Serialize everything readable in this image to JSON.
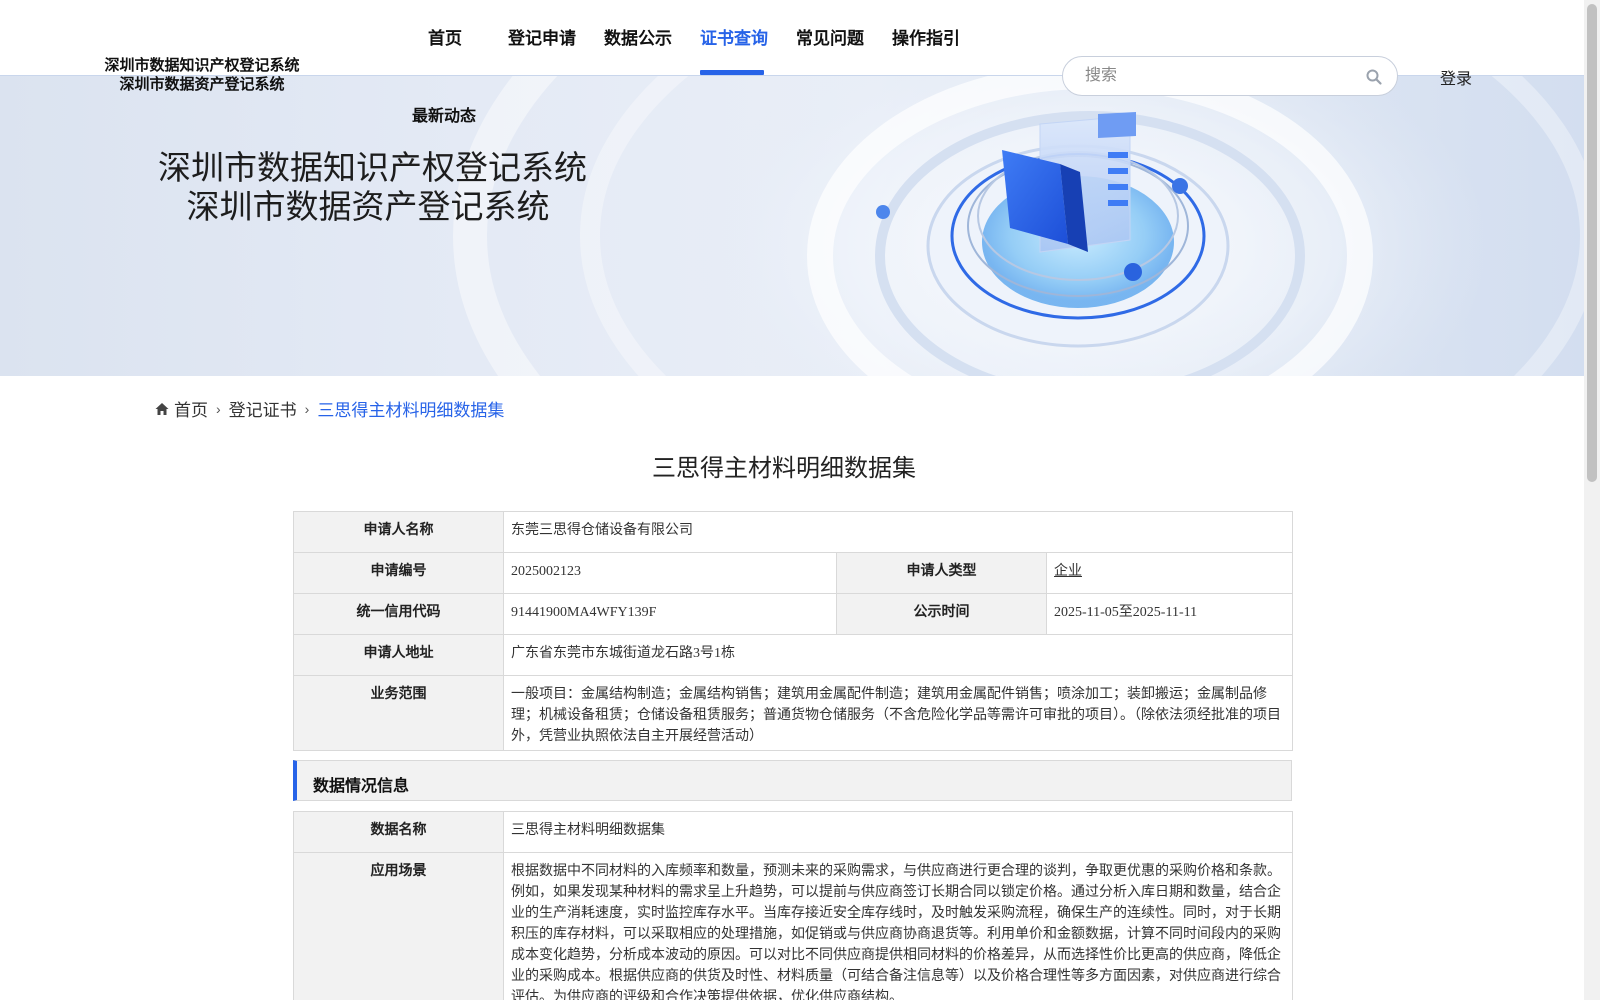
{
  "header": {
    "logo_line1": "深圳市数据知识产权登记系统",
    "logo_line2": "深圳市数据资产登记系统",
    "nav": [
      {
        "label": "首页",
        "active": false
      },
      {
        "label": "登记申请",
        "active": false
      },
      {
        "label": "数据公示",
        "active": false
      },
      {
        "label": "证书查询",
        "active": true
      },
      {
        "label": "常见问题",
        "active": false
      },
      {
        "label": "操作指引",
        "active": false
      }
    ],
    "nav_extra": "最新动态",
    "search_placeholder": "搜索",
    "search_icon": "search-icon",
    "login_label": "登录",
    "accent_color": "#2763e8"
  },
  "banner": {
    "title_line1": "深圳市数据知识产权登记系统",
    "title_line2": "深圳市数据资产登记系统"
  },
  "breadcrumb": {
    "home_icon": "home-icon",
    "items": [
      "首页",
      "登记证书",
      "三思得主材料明细数据集"
    ]
  },
  "page_title": "三思得主材料明细数据集",
  "applicant_info": {
    "applicant_name_label": "申请人名称",
    "applicant_name": "东莞三思得仓储设备有限公司",
    "app_no_label": "申请编号",
    "app_no": "2025002123",
    "applicant_type_label": "申请人类型",
    "applicant_type": "企业",
    "credit_code_label": "统一信用代码",
    "credit_code": "91441900MA4WFY139F",
    "publicity_time_label": "公示时间",
    "publicity_time": "2025-11-05至2025-11-11",
    "address_label": "申请人地址",
    "address": "广东省东莞市东城街道龙石路3号1栋",
    "business_scope_label": "业务范围",
    "business_scope": "一般项目：金属结构制造；金属结构销售；建筑用金属配件制造；建筑用金属配件销售；喷涂加工；装卸搬运；金属制品修理；机械设备租赁；仓储设备租赁服务；普通货物仓储服务（不含危险化学品等需许可审批的项目）。（除依法须经批准的项目外，凭营业执照依法自主开展经营活动）"
  },
  "data_info": {
    "section_title": "数据情况信息",
    "data_name_label": "数据名称",
    "data_name": "三思得主材料明细数据集",
    "scenario_label": "应用场景",
    "scenario": "根据数据中不同材料的入库频率和数量，预测未来的采购需求，与供应商进行更合理的谈判，争取更优惠的采购价格和条款。例如，如果发现某种材料的需求呈上升趋势，可以提前与供应商签订长期合同以锁定价格。通过分析入库日期和数量，结合企业的生产消耗速度，实时监控库存水平。当库存接近安全库存线时，及时触发采购流程，确保生产的连续性。同时，对于长期积压的库存材料，可以采取相应的处理措施，如促销或与供应商协商退货等。利用单价和金额数据，计算不同时间段内的采购成本变化趋势，分析成本波动的原因。可以对比不同供应商提供相同材料的价格差异，从而选择性价比更高的供应商，降低企业的采购成本。根据供应商的供货及时性、材料质量（可结合备注信息等）以及价格合理性等多方面因素，对供应商进行综合评估。为供应商的评级和合作决策提供依据，优化供应商结构。"
  }
}
